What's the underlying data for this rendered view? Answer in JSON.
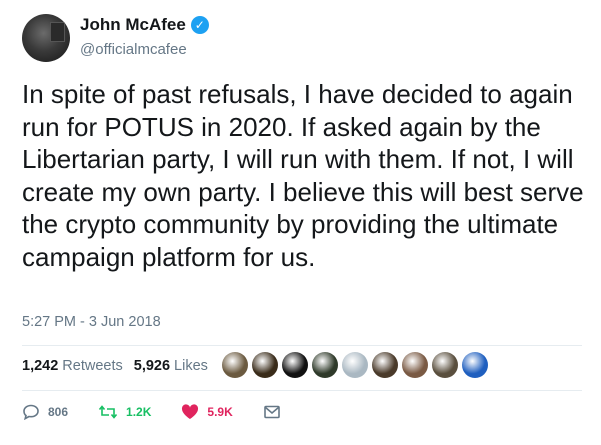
{
  "author": {
    "name": "John McAfee",
    "handle": "@officialmcafee",
    "verified_mark": "✓"
  },
  "tweet": {
    "text": "In spite of past refusals, I have decided to again run for POTUS in 2020. If asked again by the Libertarian party, I will run with them. If not, I will create my own party. I believe this will best serve the crypto community by providing the ultimate campaign platform for us.",
    "timestamp": "5:27 PM - 3 Jun 2018"
  },
  "stats": {
    "retweets_count": "1,242",
    "retweets_label": "Retweets",
    "likes_count": "5,926",
    "likes_label": "Likes"
  },
  "liker_avatars": [
    "#6b5a40",
    "#3a2c1a",
    "#111111",
    "#2f3a2a",
    "#aab8c2",
    "#4a3a2a",
    "#7a5a44",
    "#5a4f3e",
    "#1f5fbf"
  ],
  "actions": {
    "reply_count": "806",
    "retweet_count": "1.2K",
    "like_count": "5.9K"
  },
  "colors": {
    "accent": "#1da1f2",
    "retweet": "#17bf63",
    "like": "#e0245e",
    "muted": "#657786"
  },
  "icons": [
    "verified-icon",
    "reply-icon",
    "retweet-icon",
    "heart-icon",
    "message-icon"
  ]
}
